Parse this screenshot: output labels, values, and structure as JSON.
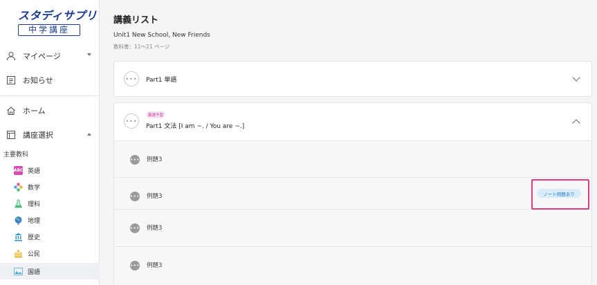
{
  "sidebar": {
    "logo": {
      "main": "スタディサプリ",
      "sub": "中学講座"
    },
    "nav": [
      {
        "label": "マイページ",
        "icon": "user-icon"
      },
      {
        "label": "お知らせ",
        "icon": "news-icon"
      },
      {
        "label": "ホーム",
        "icon": "home-icon"
      },
      {
        "label": "講座選択",
        "icon": "course-select-icon"
      }
    ],
    "section_label": "主要教科",
    "subjects": [
      {
        "label": "英語",
        "icon": "english-icon",
        "color": "#d64fb0"
      },
      {
        "label": "数学",
        "icon": "math-icon",
        "color": "#4aa3e0"
      },
      {
        "label": "理科",
        "icon": "science-icon",
        "color": "#4cb87a"
      },
      {
        "label": "地理",
        "icon": "geography-icon",
        "color": "#3b7fd1"
      },
      {
        "label": "歴史",
        "icon": "history-icon",
        "color": "#3a93c9"
      },
      {
        "label": "公民",
        "icon": "civics-icon",
        "color": "#e3b13b"
      },
      {
        "label": "国語",
        "icon": "japanese-icon",
        "color": "#5aa7d6"
      }
    ]
  },
  "main": {
    "title": "講義リスト",
    "unit": "Unit1 New School, New Friends",
    "textbook": "教科書：11〜21 ページ",
    "parts": [
      {
        "title": "Part1 単語",
        "expanded": false
      },
      {
        "title": "Part1 文法 [I am ~. / You are ~.]",
        "badge": "厳選予習",
        "expanded": true
      }
    ],
    "examples": [
      {
        "label": "例題3"
      },
      {
        "label": "例題3",
        "note_badge": "ノート問題あり"
      },
      {
        "label": "例題3"
      },
      {
        "label": "例題3"
      }
    ]
  },
  "colors": {
    "accent": "#1a3c8f",
    "highlight_border": "#e23a7b",
    "note_badge_bg": "#d9ecfb"
  }
}
